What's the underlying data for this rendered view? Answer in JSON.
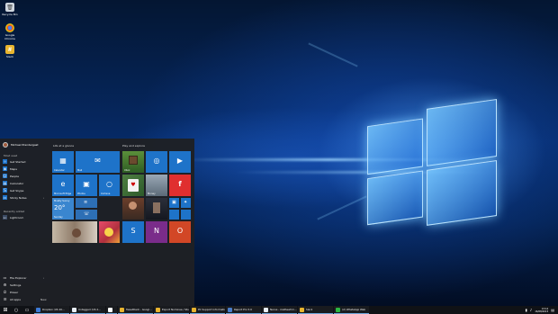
{
  "desktop": {
    "icons": [
      {
        "label": "Recycle Bin",
        "icon": "recycle-bin-icon",
        "color": "#cfd6de"
      },
      {
        "label": "Google Chrome",
        "icon": "chrome-icon",
        "color": "#e33b2e"
      },
      {
        "label": "Slack",
        "icon": "slack-icon",
        "color": "#e9b52f"
      }
    ]
  },
  "start_menu": {
    "user_name": "Michael Prendergast",
    "most_used_label": "Most used",
    "most_used": [
      {
        "label": "Get Started",
        "icon": "lightbulb-icon"
      },
      {
        "label": "Maps",
        "icon": "maps-icon"
      },
      {
        "label": "People",
        "icon": "people-icon"
      },
      {
        "label": "Calculator",
        "icon": "calculator-icon"
      },
      {
        "label": "Get Skype",
        "icon": "skype-icon"
      },
      {
        "label": "Sticky Notes",
        "icon": "sticky-notes-icon"
      }
    ],
    "recently_added_label": "Recently added",
    "recently_added": [
      {
        "label": "Lightroom",
        "icon": "lightroom-icon"
      }
    ],
    "bottom_items": [
      {
        "label": "File Explorer",
        "icon": "folder-icon"
      },
      {
        "label": "Settings",
        "icon": "gear-icon"
      },
      {
        "label": "Power",
        "icon": "power-icon"
      },
      {
        "label": "All apps",
        "icon": "list-icon",
        "badge": "New"
      }
    ],
    "groups": [
      {
        "title": "Life at a glance"
      },
      {
        "title": "Play and explore"
      }
    ],
    "tiles_life": [
      {
        "label": "Calendar",
        "glyph": "▦",
        "color": "#1e73c9",
        "icon": "calendar-icon"
      },
      {
        "label": "Mail",
        "glyph": "✉",
        "color": "#1e73c9",
        "icon": "mail-icon"
      },
      {
        "label": "Microsoft Edge",
        "glyph": "e",
        "color": "#1e73c9",
        "icon": "edge-icon"
      },
      {
        "label": "Photos",
        "glyph": "▣",
        "color": "#1e73c9",
        "icon": "photos-icon"
      },
      {
        "label": "Cortana",
        "glyph": "○",
        "color": "#1e73c9",
        "icon": "cortana-icon"
      },
      {
        "label": "Sunday",
        "glyph": "",
        "color": "#3a86cf",
        "icon": "weather-icon",
        "detail_title": "Mostly Sunny",
        "detail_temp": "20°"
      },
      {
        "label": "",
        "glyph": "",
        "color": "#2d6fb5",
        "icon": "news-icon"
      },
      {
        "label": "",
        "glyph": "",
        "color": "#2d6fb5",
        "icon": "phone-icon"
      },
      {
        "label": "",
        "glyph": "",
        "color": "#c4b8a6",
        "icon": "photo-collage-icon"
      },
      {
        "label": "",
        "glyph": "",
        "color": "#b0303d",
        "icon": "candy-crush-icon"
      }
    ],
    "tiles_play": [
      {
        "label": "Xbox",
        "glyph": "",
        "color": "#2e7d32",
        "icon": "minecraft-icon"
      },
      {
        "label": "",
        "glyph": "◎",
        "color": "#1e73c9",
        "icon": "groove-icon"
      },
      {
        "label": "",
        "glyph": "▶",
        "color": "#1e73c9",
        "icon": "movies-icon"
      },
      {
        "label": "",
        "glyph": "",
        "color": "#3b6e3a",
        "icon": "solitaire-icon"
      },
      {
        "label": "Money",
        "glyph": "",
        "color": "#1e73c9",
        "icon": "money-icon"
      },
      {
        "label": "",
        "glyph": "",
        "color": "#1e73c9",
        "icon": "sports-icon"
      },
      {
        "label": "",
        "glyph": "f",
        "color": "#e02f2f",
        "icon": "flipboard-icon"
      },
      {
        "label": "",
        "glyph": "",
        "color": "#4a3a2c",
        "icon": "news-photo-icon"
      },
      {
        "label": "",
        "glyph": "",
        "color": "#1e73c9",
        "icon": "store-icon"
      },
      {
        "label": "",
        "glyph": "",
        "color": "#1e73c9",
        "icon": "twitter-icon"
      },
      {
        "label": "",
        "glyph": "S",
        "color": "#1e73c9",
        "icon": "shazam-icon"
      },
      {
        "label": "",
        "glyph": "N",
        "color": "#7a2c8a",
        "icon": "onenote-icon"
      },
      {
        "label": "",
        "glyph": "O",
        "color": "#d24726",
        "icon": "office-icon"
      }
    ]
  },
  "taskbar": {
    "apps": [
      {
        "label": "Dropbox (US 20...",
        "color": "#3d7ad6",
        "icon": "dropbox-icon"
      },
      {
        "label": "Untagged (US 2...",
        "color": "#e8eef6",
        "icon": "windows-icon"
      },
      {
        "label": "",
        "color": "#ffffff",
        "icon": "blank-icon"
      },
      {
        "label": "TweetDeck - Googl...",
        "color": "#e8b32f",
        "icon": "chrome-icon"
      },
      {
        "label": "Export Nominee / Sto...",
        "color": "#e8b32f",
        "icon": "chrome-icon"
      },
      {
        "label": "PC Support Informatio...",
        "color": "#e8b32f",
        "icon": "chrome-icon"
      },
      {
        "label": "Report Pro 5.0",
        "color": "#4a7dc9",
        "icon": "app-icon"
      },
      {
        "label": "Nerve - mathewhm...",
        "color": "#e8eef6",
        "icon": "windows-icon"
      },
      {
        "label": "Slack",
        "color": "#e9b52f",
        "icon": "slack-icon"
      },
      {
        "label": "(2) WhatsApp Web",
        "color": "#2cb742",
        "icon": "whatsapp-icon"
      }
    ],
    "clock_time": "13:14",
    "clock_date": "16/08/2015"
  }
}
